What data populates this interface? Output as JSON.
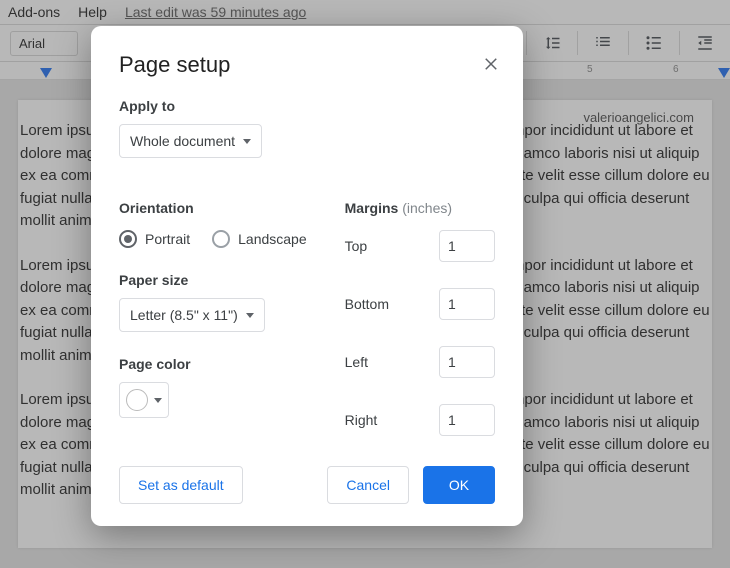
{
  "menu": {
    "addons": "Add-ons",
    "help": "Help",
    "last_edit": "Last edit was 59 minutes ago"
  },
  "toolbar": {
    "font": "Arial"
  },
  "ruler": {
    "num5": "5",
    "num6": "6"
  },
  "doc": {
    "watermark": "valerioangelici.com",
    "p1": "Lorem ipsum dolor sit amet, consectetur adipiscing elit, sed do eiusmod tempor incididunt ut labore et dolore magna aliqua. Ut enim ad minim veniam, quis nostrud exercitation ullamco laboris nisi ut aliquip ex ea commodo consequat. Duis aute irure dolor in reprehenderit in voluptate velit esse cillum dolore eu fugiat nulla pariatur. Excepteur sint occaecat cupidatat non proident, sunt in culpa qui officia deserunt mollit anim id est laborum.",
    "p2": "Lorem ipsum dolor sit amet, consectetur adipiscing elit, sed do eiusmod tempor incididunt ut labore et dolore magna aliqua. Ut enim ad minim veniam, quis nostrud exercitation ullamco laboris nisi ut aliquip ex ea commodo consequat. Duis aute irure dolor in reprehenderit in voluptate velit esse cillum dolore eu fugiat nulla pariatur. Excepteur sint occaecat cupidatat non proident, sunt in culpa qui officia deserunt mollit anim id est laborum.",
    "p3": "Lorem ipsum dolor sit amet, consectetur adipiscing elit, sed do eiusmod tempor incididunt ut labore et dolore magna aliqua. Ut enim ad minim veniam, quis nostrud exercitation ullamco laboris nisi ut aliquip ex ea commodo consequat. Duis aute irure dolor in reprehenderit in voluptate velit esse cillum dolore eu fugiat nulla pariatur. Excepteur sint occaecat cupidatat non proident, sunt in culpa qui officia deserunt mollit anim id est laborum."
  },
  "dialog": {
    "title": "Page setup",
    "apply_to_label": "Apply to",
    "apply_to_value": "Whole document",
    "orientation_label": "Orientation",
    "orientation_portrait": "Portrait",
    "orientation_landscape": "Landscape",
    "paper_size_label": "Paper size",
    "paper_size_value": "Letter (8.5\" x 11\")",
    "page_color_label": "Page color",
    "margins_label": "Margins",
    "margins_unit": "(inches)",
    "margin_top_label": "Top",
    "margin_top_value": "1",
    "margin_bottom_label": "Bottom",
    "margin_bottom_value": "1",
    "margin_left_label": "Left",
    "margin_left_value": "1",
    "margin_right_label": "Right",
    "margin_right_value": "1",
    "set_default": "Set as default",
    "cancel": "Cancel",
    "ok": "OK"
  }
}
